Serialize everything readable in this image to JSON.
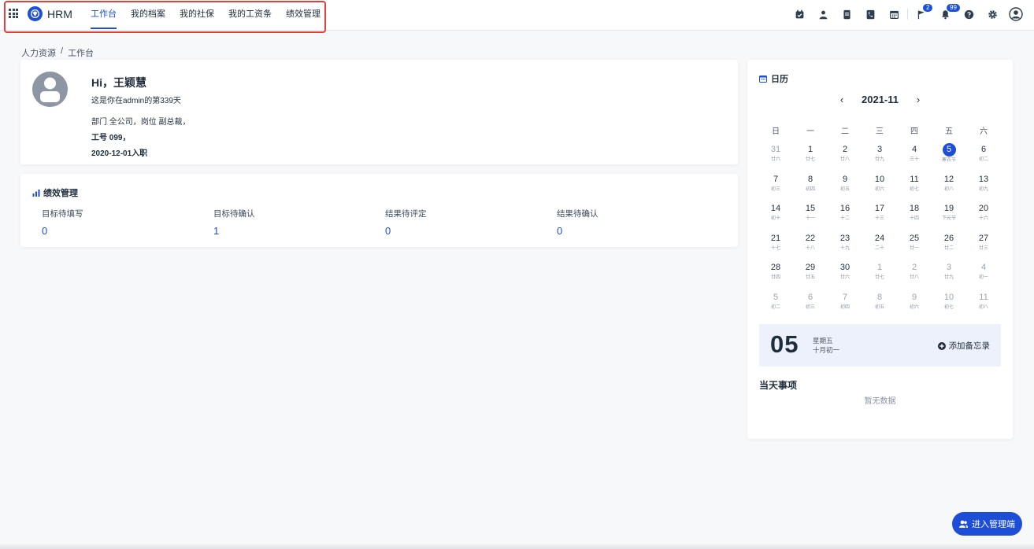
{
  "app": {
    "brand": "HRM"
  },
  "nav": {
    "items": [
      {
        "label": "工作台",
        "active": true
      },
      {
        "label": "我的档案"
      },
      {
        "label": "我的社保"
      },
      {
        "label": "我的工资条"
      },
      {
        "label": "绩效管理"
      }
    ]
  },
  "toolbar": {
    "flag_badge": "2",
    "bell_badge": "99"
  },
  "breadcrumb": {
    "root": "人力资源",
    "sep": "/",
    "current": "工作台"
  },
  "profile": {
    "greeting": "Hi，王颖慧",
    "days": "这是你在admin的第339天",
    "dept": "部门 全公司，岗位 副总裁，",
    "employee_no": "工号 099，",
    "join": "2020-12-01入职"
  },
  "performance": {
    "title": "绩效管理",
    "items": [
      {
        "label": "目标待填写",
        "value": "0"
      },
      {
        "label": "目标待确认",
        "value": "1"
      },
      {
        "label": "结果待评定",
        "value": "0"
      },
      {
        "label": "结果待确认",
        "value": "0"
      }
    ]
  },
  "calendar": {
    "title": "日历",
    "month": "2021-11",
    "weekdays": [
      "日",
      "一",
      "二",
      "三",
      "四",
      "五",
      "六"
    ],
    "days": [
      {
        "d": "31",
        "l": "廿六",
        "o": true
      },
      {
        "d": "1",
        "l": "廿七"
      },
      {
        "d": "2",
        "l": "廿八"
      },
      {
        "d": "3",
        "l": "廿九"
      },
      {
        "d": "4",
        "l": "三十"
      },
      {
        "d": "5",
        "l": "寒衣节",
        "t": true
      },
      {
        "d": "6",
        "l": "初二"
      },
      {
        "d": "7",
        "l": "初三"
      },
      {
        "d": "8",
        "l": "初四"
      },
      {
        "d": "9",
        "l": "初五"
      },
      {
        "d": "10",
        "l": "初六"
      },
      {
        "d": "11",
        "l": "初七"
      },
      {
        "d": "12",
        "l": "初八"
      },
      {
        "d": "13",
        "l": "初九"
      },
      {
        "d": "14",
        "l": "初十"
      },
      {
        "d": "15",
        "l": "十一"
      },
      {
        "d": "16",
        "l": "十二"
      },
      {
        "d": "17",
        "l": "十三"
      },
      {
        "d": "18",
        "l": "十四"
      },
      {
        "d": "19",
        "l": "下元节"
      },
      {
        "d": "20",
        "l": "十六"
      },
      {
        "d": "21",
        "l": "十七"
      },
      {
        "d": "22",
        "l": "十八"
      },
      {
        "d": "23",
        "l": "十九"
      },
      {
        "d": "24",
        "l": "二十"
      },
      {
        "d": "25",
        "l": "廿一"
      },
      {
        "d": "26",
        "l": "廿二"
      },
      {
        "d": "27",
        "l": "廿三"
      },
      {
        "d": "28",
        "l": "廿四"
      },
      {
        "d": "29",
        "l": "廿五"
      },
      {
        "d": "30",
        "l": "廿六"
      },
      {
        "d": "1",
        "l": "廿七",
        "o": true
      },
      {
        "d": "2",
        "l": "廿八",
        "o": true
      },
      {
        "d": "3",
        "l": "廿九",
        "o": true
      },
      {
        "d": "4",
        "l": "初一",
        "o": true
      },
      {
        "d": "5",
        "l": "初二",
        "o": true
      },
      {
        "d": "6",
        "l": "初三",
        "o": true
      },
      {
        "d": "7",
        "l": "初四",
        "o": true
      },
      {
        "d": "8",
        "l": "初五",
        "o": true
      },
      {
        "d": "9",
        "l": "初六",
        "o": true
      },
      {
        "d": "10",
        "l": "初七",
        "o": true
      },
      {
        "d": "11",
        "l": "初八",
        "o": true
      }
    ],
    "today": {
      "big": "05",
      "weekday": "星期五",
      "lunar": "十月初一",
      "add_memo": "添加备忘录"
    },
    "events_title": "当天事项",
    "no_data": "暂无数据"
  },
  "admin_button": "进入管理端",
  "colors": {
    "accent": "#1d4ed8",
    "highlight": "#e0413a"
  }
}
